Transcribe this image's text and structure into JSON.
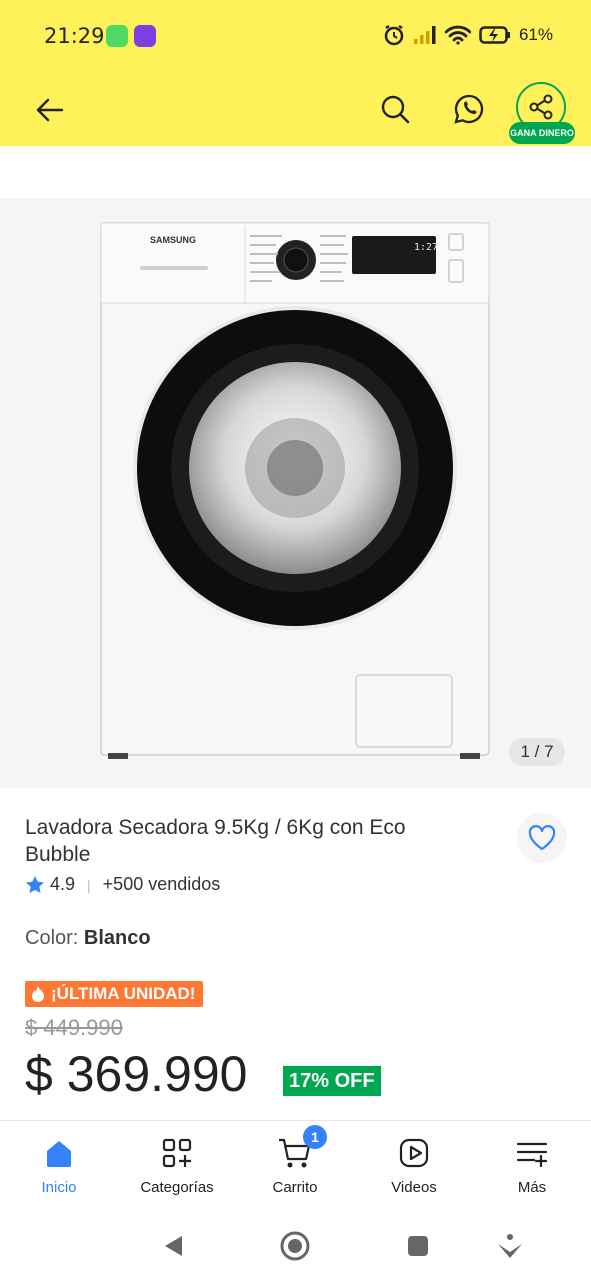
{
  "status_bar": {
    "time": "21:29",
    "battery": "61%"
  },
  "header": {
    "share_badge": "GANA DINERO"
  },
  "gallery": {
    "counter": "1 / 7",
    "brand_on_image": "SAMSUNG",
    "display_digits": "1:27"
  },
  "product": {
    "title": "Lavadora Secadora 9.5Kg / 6Kg con Eco Bubble",
    "rating": "4.9",
    "sold": "+500 vendidos",
    "color_label": "Color:",
    "color_value": "Blanco",
    "urgency_badge": "¡ÚLTIMA UNIDAD!",
    "old_price": "$ 449.990",
    "price": "$ 369.990",
    "discount": "17% OFF"
  },
  "bottom_nav": {
    "items": [
      {
        "label": "Inicio",
        "active": true
      },
      {
        "label": "Categorías"
      },
      {
        "label": "Carrito",
        "badge": "1"
      },
      {
        "label": "Videos"
      },
      {
        "label": "Más"
      }
    ]
  },
  "colors": {
    "brand_yellow": "#fff159",
    "active_blue": "#3483fa",
    "green": "#00a650",
    "orange": "#ff7733"
  }
}
